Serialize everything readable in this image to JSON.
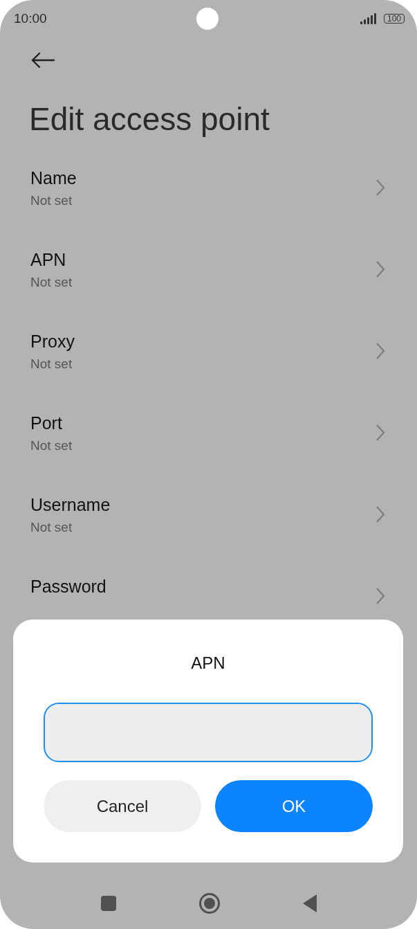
{
  "status_bar": {
    "time": "10:00",
    "battery": "100"
  },
  "title": "Edit access point",
  "settings": [
    {
      "label": "Name",
      "value": "Not set"
    },
    {
      "label": "APN",
      "value": "Not set"
    },
    {
      "label": "Proxy",
      "value": "Not set"
    },
    {
      "label": "Port",
      "value": "Not set"
    },
    {
      "label": "Username",
      "value": "Not set"
    },
    {
      "label": "Password"
    }
  ],
  "dialog": {
    "title": "APN",
    "field": {
      "focused": true
    },
    "buttons": [
      {
        "label": "Cancel",
        "kind": "secondary"
      },
      {
        "label": "OK",
        "kind": "primary"
      }
    ]
  }
}
